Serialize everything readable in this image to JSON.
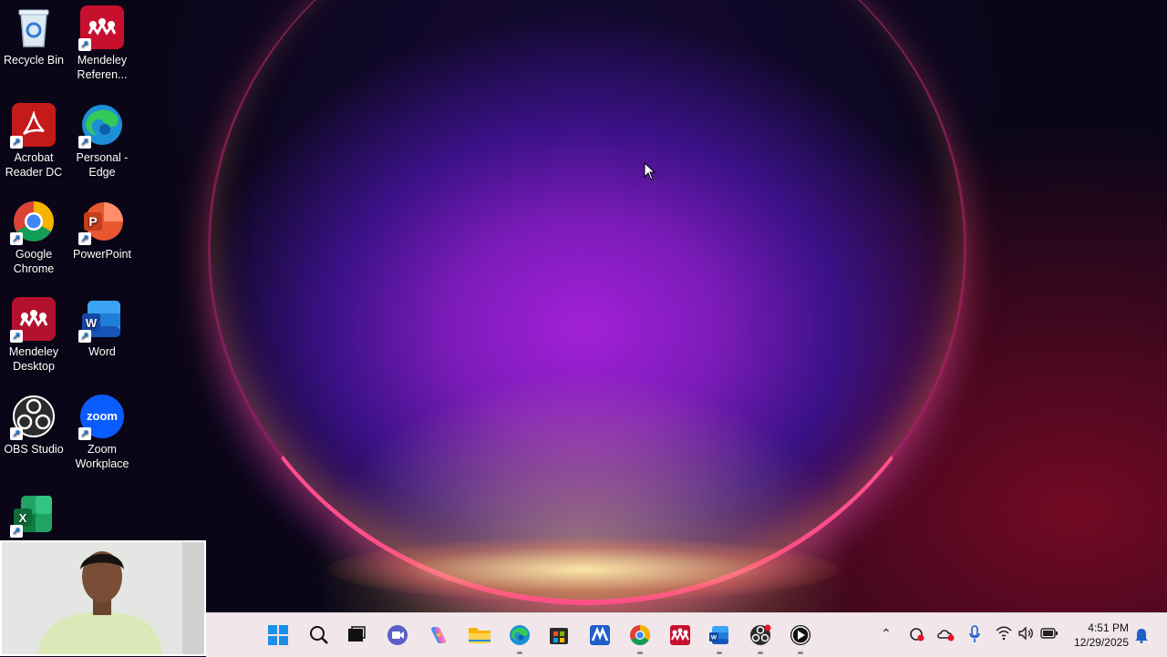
{
  "desktop": {
    "icons": [
      {
        "label": "Recycle Bin",
        "icon": "recycle-bin-icon"
      },
      {
        "label": "Mendeley Referen...",
        "icon": "mendeley-icon"
      },
      {
        "label": "Acrobat Reader DC",
        "icon": "acrobat-icon"
      },
      {
        "label": "Personal - Edge",
        "icon": "edge-icon"
      },
      {
        "label": "Google Chrome",
        "icon": "chrome-icon"
      },
      {
        "label": "PowerPoint",
        "icon": "powerpoint-icon"
      },
      {
        "label": "Mendeley Desktop",
        "icon": "mendeley-icon"
      },
      {
        "label": "Word",
        "icon": "word-icon"
      },
      {
        "label": "OBS Studio",
        "icon": "obs-icon"
      },
      {
        "label": "Zoom Workplace",
        "icon": "zoom-icon",
        "logo_text": "zoom"
      },
      {
        "label": "",
        "icon": "excel-icon"
      }
    ]
  },
  "taskbar": {
    "apps": [
      "windows-start-icon",
      "search-icon",
      "task-view-icon",
      "teams-meet-icon",
      "copilot-icon",
      "file-explorer-icon",
      "edge-icon",
      "store-icon",
      "mendeley-web-icon",
      "chrome-icon",
      "mendeley-icon",
      "word-icon",
      "obs-icon",
      "media-player-icon"
    ],
    "tray": [
      "chevron-up-icon",
      "sync-icon",
      "onedrive-icon",
      "microphone-icon",
      "wifi-icon",
      "volume-icon",
      "battery-icon",
      "bell-icon"
    ],
    "time": "4:51 PM",
    "date": "12/29/2025"
  },
  "colors": {
    "taskbar_bg": "#f1e6ea",
    "accent": "#0a64d6"
  }
}
